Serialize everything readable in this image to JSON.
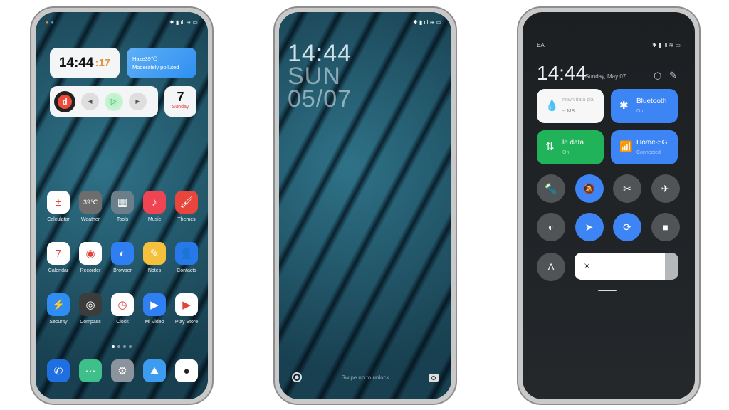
{
  "home": {
    "clock_hm": "14:44",
    "clock_sec": "17",
    "weather_line1": "Haze39℃",
    "weather_line2": "Moderately polluted",
    "calendar_day": "7",
    "calendar_weekday": "Sunday",
    "apps": [
      {
        "label": "Calculator",
        "color": "#ffffff",
        "glyph": "±"
      },
      {
        "label": "Weather",
        "color": "#6d6d6d",
        "glyph": "39℃"
      },
      {
        "label": "Tools",
        "color": "#6a7f8a",
        "glyph": "▦"
      },
      {
        "label": "Music",
        "color": "#ef4452",
        "glyph": "♪"
      },
      {
        "label": "Themes",
        "color": "#e8453c",
        "glyph": "🖌"
      },
      {
        "label": "Calendar",
        "color": "#ffffff",
        "glyph": "7"
      },
      {
        "label": "Recorder",
        "color": "#ffffff",
        "glyph": "◉"
      },
      {
        "label": "Browser",
        "color": "#2f7ff2",
        "glyph": "◐"
      },
      {
        "label": "Notes",
        "color": "#f5c13d",
        "glyph": "✎"
      },
      {
        "label": "Contacts",
        "color": "#2878ea",
        "glyph": "👤"
      },
      {
        "label": "Security",
        "color": "#2f8cf2",
        "glyph": "⚡"
      },
      {
        "label": "Compass",
        "color": "#3c3c3c",
        "glyph": "◎"
      },
      {
        "label": "Clock",
        "color": "#ffffff",
        "glyph": "◷"
      },
      {
        "label": "Mi Video",
        "color": "#2f7ff2",
        "glyph": "▶"
      },
      {
        "label": "Play Store",
        "color": "#ffffff",
        "glyph": "▶"
      }
    ],
    "dock": [
      {
        "name": "phone",
        "color": "#1f6fe0",
        "glyph": "✆"
      },
      {
        "name": "messages",
        "color": "#3fc08a",
        "glyph": "⋯"
      },
      {
        "name": "settings",
        "color": "#8b949c",
        "glyph": "⚙"
      },
      {
        "name": "gallery",
        "color": "#3d9cf0",
        "glyph": "⛰"
      },
      {
        "name": "camera",
        "color": "#ffffff",
        "glyph": "●"
      }
    ],
    "page_count": 4,
    "active_page": 1
  },
  "lock": {
    "time": "14:44",
    "day": "SUN",
    "date": "05/07",
    "hint": "Swipe up to unlock"
  },
  "control": {
    "carrier": "EA",
    "time": "14:44",
    "date": "Sunday, May 07",
    "tiles": [
      {
        "title": "nown data pla",
        "sub": "-- MB",
        "color": "#f7f7f7",
        "icon": "💧"
      },
      {
        "title": "Bluetooth",
        "sub": "On",
        "color": "#3d84f5",
        "icon": "✱"
      },
      {
        "title": "le data",
        "sub": "On",
        "color": "#21b35a",
        "icon": "⇅"
      },
      {
        "title": "Home-5G",
        "sub": "Connected",
        "color": "#3d84f5",
        "icon": "📶"
      }
    ],
    "toggles": [
      {
        "name": "flashlight",
        "on": false,
        "glyph": "🔦"
      },
      {
        "name": "mute",
        "on": true,
        "glyph": "🔕"
      },
      {
        "name": "screenshot",
        "on": false,
        "glyph": "✂"
      },
      {
        "name": "airplane",
        "on": false,
        "glyph": "✈"
      },
      {
        "name": "reading-mode",
        "on": false,
        "glyph": "◐"
      },
      {
        "name": "location",
        "on": true,
        "glyph": "➤"
      },
      {
        "name": "rotation-lock",
        "on": true,
        "glyph": "⟳"
      },
      {
        "name": "screen-recorder",
        "on": false,
        "glyph": "■"
      }
    ],
    "auto_brightness": "A",
    "brightness_percent": 87
  }
}
